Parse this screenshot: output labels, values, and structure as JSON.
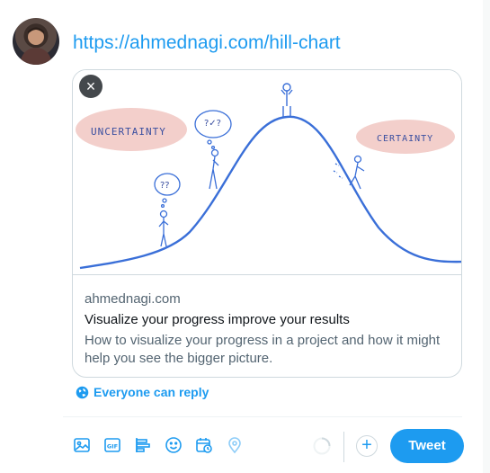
{
  "tweet": {
    "text_url": "https://ahmednagi.com/hill-chart"
  },
  "card": {
    "image_labels": {
      "left": "UNCERTAINTY",
      "right": "CERTAINTY",
      "thought_left": "??",
      "thought_mid": "?✓?"
    },
    "domain": "ahmednagi.com",
    "title": "Visualize your progress improve your results",
    "description": "How to visualize your progress in a project and how it might help you see the bigger picture."
  },
  "reply_setting": {
    "label": "Everyone can reply",
    "icon": "globe-icon"
  },
  "toolbar": {
    "icons": [
      "image-icon",
      "gif-icon",
      "poll-icon",
      "emoji-icon",
      "schedule-icon",
      "location-icon"
    ],
    "tweet_label": "Tweet",
    "add_label": "+"
  },
  "colors": {
    "accent": "#1d9bf0",
    "pink": "#f3cfcb",
    "sketch": "#3a6fd8"
  }
}
